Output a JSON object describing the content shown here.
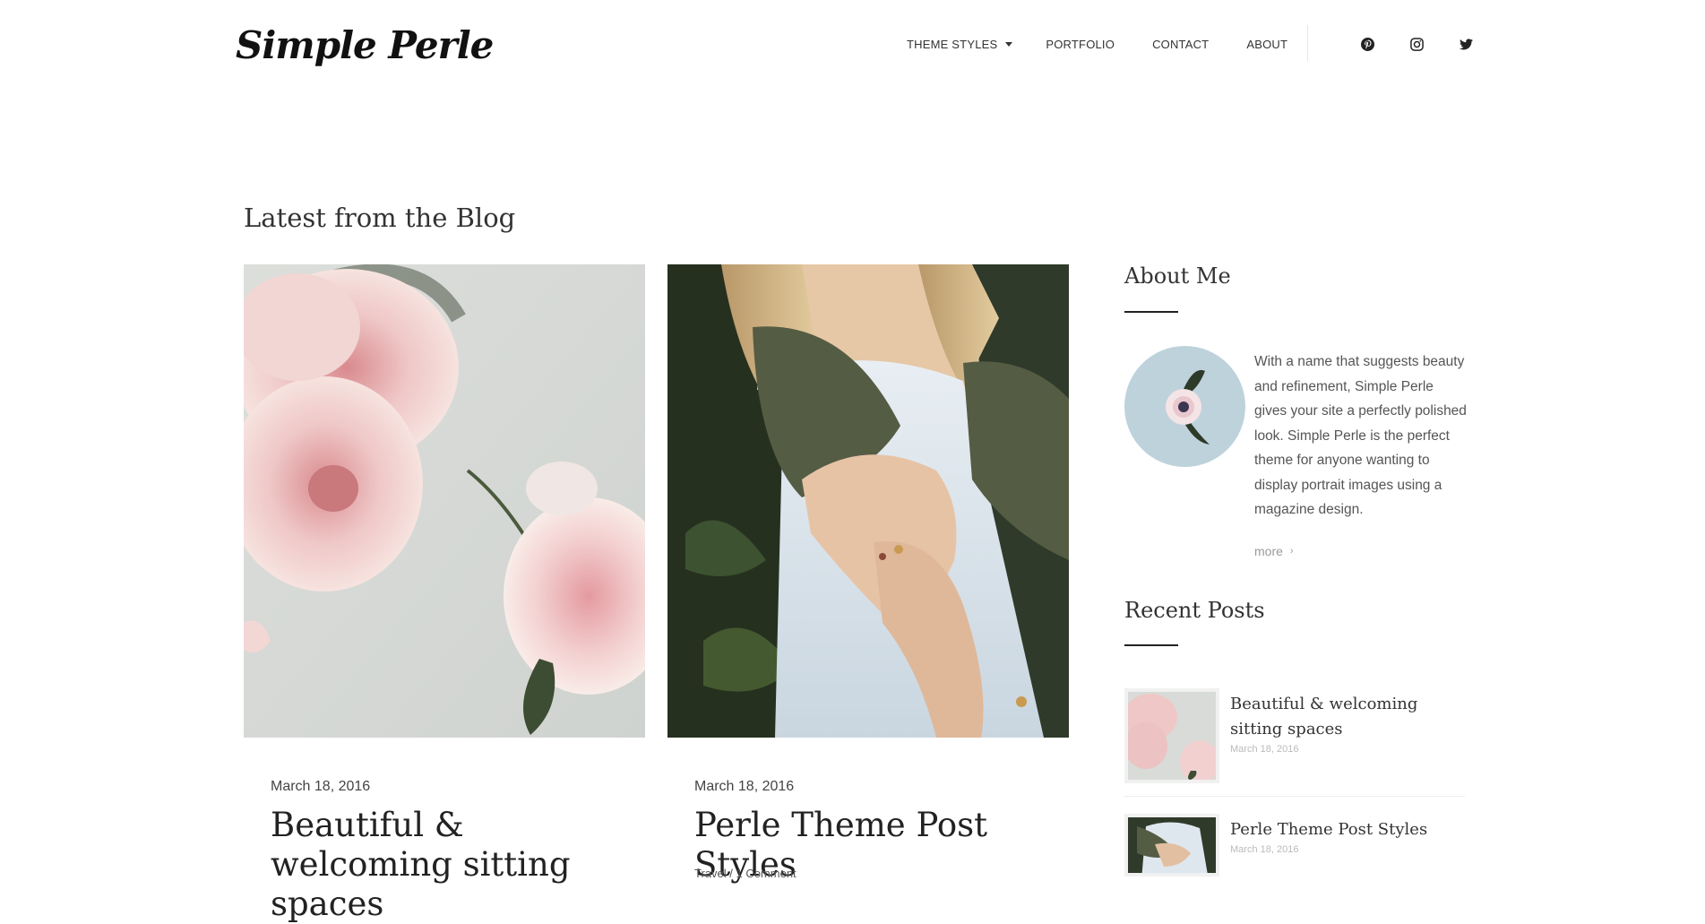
{
  "site": {
    "logo_text": "Simple Perle"
  },
  "nav": {
    "items": [
      {
        "label": "THEME STYLES",
        "has_dropdown": true
      },
      {
        "label": "PORTFOLIO",
        "has_dropdown": false
      },
      {
        "label": "CONTACT",
        "has_dropdown": false
      },
      {
        "label": "ABOUT",
        "has_dropdown": false
      }
    ],
    "social_icons": [
      "pinterest-icon",
      "instagram-icon",
      "twitter-icon"
    ]
  },
  "blog": {
    "section_title": "Latest from the Blog",
    "posts": [
      {
        "date": "March 18, 2016",
        "title": "Beautiful & welcoming sitting spaces",
        "image": "pink-roses-photo"
      },
      {
        "date": "March 18, 2016",
        "title": "Perle Theme Post Styles",
        "meta": "Travel / 1 Comment",
        "image": "woman-crossed-arms-photo"
      }
    ]
  },
  "sidebar": {
    "about": {
      "title": "About Me",
      "text": "With a name that suggests beauty and refinement, Simple Perle gives your site a perfectly polished look. Simple Perle is the perfect theme for anyone wanting to display portrait images using a magazine design.",
      "more_label": "more",
      "avatar": "flower-avatar"
    },
    "recent": {
      "title": "Recent Posts",
      "items": [
        {
          "title": "Beautiful & welcoming sitting spaces",
          "date": "March 18, 2016"
        },
        {
          "title": "Perle Theme Post Styles",
          "date": "March 18, 2016"
        }
      ]
    }
  },
  "colors": {
    "text_dark": "#222222",
    "text_muted": "#555555",
    "date_light": "#bbbbbb",
    "background": "#ffffff"
  }
}
